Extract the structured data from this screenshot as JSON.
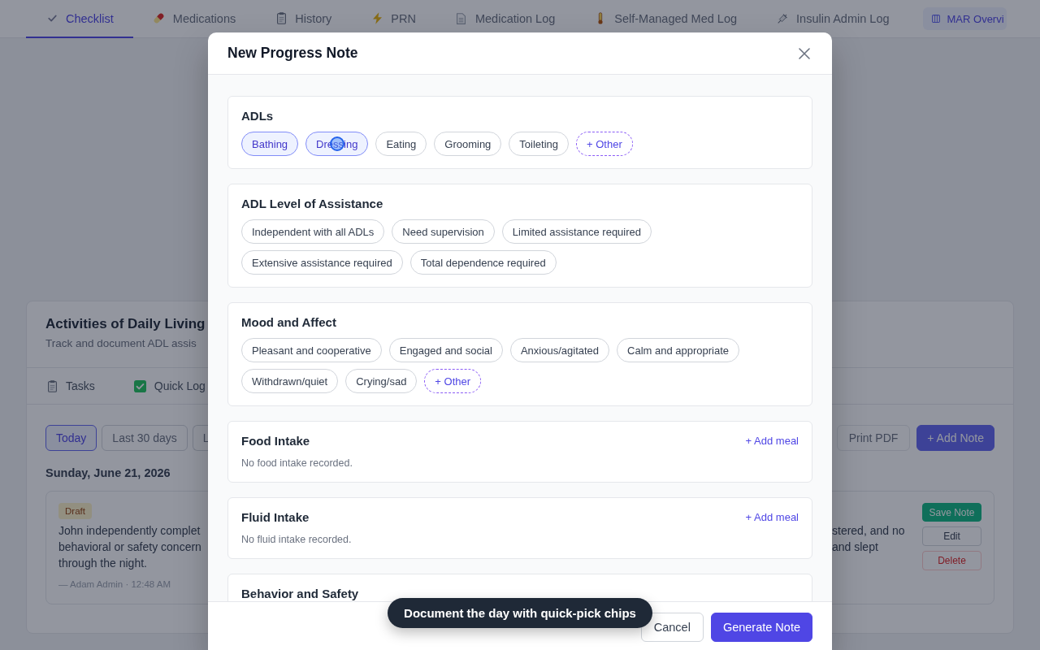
{
  "tabs": [
    {
      "kind": "tab",
      "label": "Checklist",
      "selected": true
    },
    {
      "kind": "tab",
      "label": "Medications",
      "selected": false
    },
    {
      "kind": "tab",
      "label": "History",
      "selected": false
    },
    {
      "kind": "tab",
      "label": "PRN",
      "selected": false
    },
    {
      "kind": "tab",
      "label": "Medication Log",
      "selected": false
    },
    {
      "kind": "tab",
      "label": "Self-Managed Med Log",
      "selected": false
    },
    {
      "kind": "tab",
      "label": "Insulin Admin Log",
      "selected": false
    },
    {
      "kind": "pill",
      "label": "MAR Overvi",
      "selected": false
    }
  ],
  "adl": {
    "title": "Activities of Daily Living",
    "subtitle": "Track and document ADL assis",
    "views": [
      "Tasks",
      "Quick Log"
    ],
    "filters": [
      {
        "label": "Today",
        "selected": true
      },
      {
        "label": "Last 30 days",
        "selected": false
      },
      {
        "label": "L",
        "selected": false
      }
    ],
    "actions": [
      {
        "kind": "secondary",
        "label": "Print PDF"
      },
      {
        "kind": "primary",
        "label": "+ Add Note"
      }
    ],
    "date": "Sunday, June 21, 2026",
    "note": {
      "status": "Draft",
      "text_left": [
        "John independently complet",
        "behavioral or safety concern",
        "through the night."
      ],
      "text_right": [
        "stered, and no",
        "and slept"
      ],
      "byline": "— Adam Admin · 12:48 AM",
      "buttons": [
        {
          "kind": "success",
          "label": "Save Note"
        },
        {
          "kind": "neutral",
          "label": "Edit"
        },
        {
          "kind": "danger",
          "label": "Delete"
        }
      ]
    }
  },
  "modal": {
    "title": "New Progress Note",
    "sections": [
      {
        "kind": "chips",
        "title": "ADLs",
        "chips": [
          {
            "kind": "option",
            "label": "Bathing",
            "selected": true,
            "clicked": false
          },
          {
            "kind": "option",
            "label": "Dressing",
            "selected": true,
            "clicked": true
          },
          {
            "kind": "option",
            "label": "Eating",
            "selected": false,
            "clicked": false
          },
          {
            "kind": "option",
            "label": "Grooming",
            "selected": false,
            "clicked": false
          },
          {
            "kind": "option",
            "label": "Toileting",
            "selected": false,
            "clicked": false
          },
          {
            "kind": "add",
            "label": "+ Other",
            "selected": false,
            "clicked": false
          }
        ]
      },
      {
        "kind": "chips",
        "title": "ADL Level of Assistance",
        "chips": [
          {
            "kind": "option",
            "label": "Independent with all ADLs",
            "selected": false,
            "clicked": false
          },
          {
            "kind": "option",
            "label": "Need supervision",
            "selected": false,
            "clicked": false
          },
          {
            "kind": "option",
            "label": "Limited assistance required",
            "selected": false,
            "clicked": false
          },
          {
            "kind": "option",
            "label": "Extensive assistance required",
            "selected": false,
            "clicked": false
          },
          {
            "kind": "option",
            "label": "Total dependence required",
            "selected": false,
            "clicked": false
          }
        ]
      },
      {
        "kind": "chips",
        "title": "Mood and Affect",
        "chips": [
          {
            "kind": "option",
            "label": "Pleasant and cooperative",
            "selected": false,
            "clicked": false
          },
          {
            "kind": "option",
            "label": "Engaged and social",
            "selected": false,
            "clicked": false
          },
          {
            "kind": "option",
            "label": "Anxious/agitated",
            "selected": false,
            "clicked": false
          },
          {
            "kind": "option",
            "label": "Calm and appropriate",
            "selected": false,
            "clicked": false
          },
          {
            "kind": "option",
            "label": "Withdrawn/quiet",
            "selected": false,
            "clicked": false
          },
          {
            "kind": "option",
            "label": "Crying/sad",
            "selected": false,
            "clicked": false
          },
          {
            "kind": "add",
            "label": "+ Other",
            "selected": false,
            "clicked": false
          }
        ]
      },
      {
        "kind": "log",
        "title": "Food Intake",
        "action": "+ Add meal",
        "empty_text": "No food intake recorded."
      },
      {
        "kind": "log",
        "title": "Fluid Intake",
        "action": "+ Add meal",
        "empty_text": "No fluid intake recorded."
      },
      {
        "kind": "chips",
        "title": "Behavior and Safety"
      }
    ],
    "buttons": [
      {
        "kind": "secondary",
        "label": "Cancel"
      },
      {
        "kind": "primary",
        "label": "Generate Note"
      }
    ]
  },
  "toast": {
    "text": "Document the day with quick-pick chips"
  }
}
